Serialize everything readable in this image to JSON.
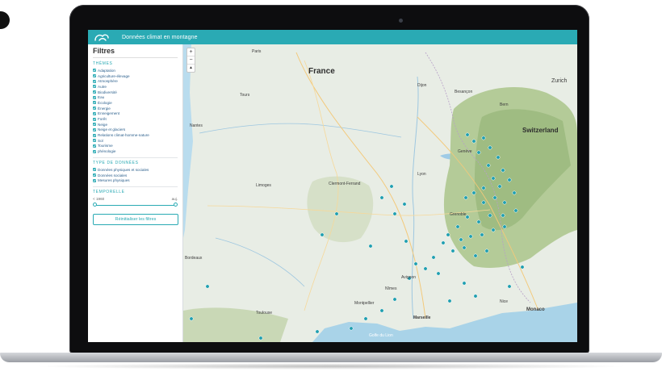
{
  "header": {
    "title": "Données climat en montagne"
  },
  "sidebar": {
    "title": "Filtres",
    "themes_label": "THÈMES",
    "themes": [
      "Adaptation",
      "Agriculture-élevage",
      "Atmosphère",
      "Autre",
      "Biodiversité",
      "Eau",
      "Écologie",
      "Énergie",
      "Enneigement",
      "Forêt",
      "Neige",
      "Neige et glaciers",
      "Relations climat-homme-nature",
      "Sol",
      "Tourisme",
      "phénologie"
    ],
    "data_type_label": "TYPE DE DONNÉES",
    "data_types": [
      "Données physiques et sociales",
      "Données sociales",
      "Mesures physiques"
    ],
    "temporal_label": "TEMPORELLE",
    "slider": {
      "min_label": "< 1960",
      "max_label": "auj."
    },
    "reset_label": "Réinitialiser les filtres"
  },
  "map": {
    "zoom_in": "+",
    "zoom_out": "−",
    "compass": "▲",
    "labels": {
      "france": "France",
      "switzerland": "Switzerland",
      "zurich": "Zurich",
      "bern": "Bern",
      "paris": "Paris",
      "tours": "Tours",
      "dijon": "Dijon",
      "besancon": "Besançon",
      "lyon": "Lyon",
      "geneve": "Genève",
      "nantes": "Nantes",
      "limoges": "Limoges",
      "clermont": "Clermont-Ferrand",
      "grenoble": "Grenoble",
      "bordeaux": "Bordeaux",
      "toulouse": "Toulouse",
      "montpellier": "Montpellier",
      "marseille": "Marseille",
      "nice": "Nice",
      "monaco": "Monaco",
      "nimes": "Nîmes",
      "avignon": "Avignon",
      "gulf": "Golfe du Lion"
    },
    "marker_color": "#1f9fb0"
  },
  "colors": {
    "accent": "#2aaab4",
    "water": "#a9d3e8",
    "land": "#e9eee6",
    "mountains": "#a9c48e"
  }
}
